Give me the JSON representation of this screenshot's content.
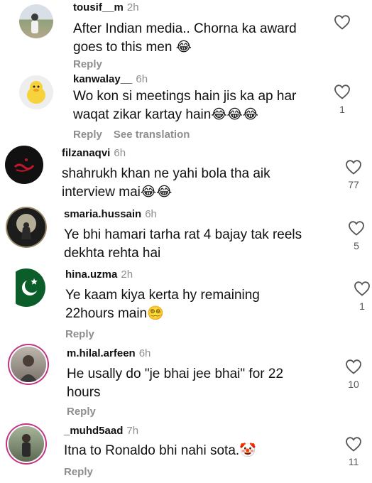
{
  "comments": [
    {
      "username": "tousif__m",
      "time": "2h",
      "text": "After Indian media.. Chorna ka award goes to this men 😂",
      "reply": "Reply",
      "see_translation": "",
      "likes": ""
    },
    {
      "username": "kanwalay__",
      "time": "6h",
      "text": "Wo kon si meetings hain jis ka ap har waqat zikar kartay hain😂😂😂",
      "reply": "Reply",
      "see_translation": "See translation",
      "likes": "1"
    },
    {
      "username": "filzanaqvi",
      "time": "6h",
      "text": "shahrukh khan ne yahi bola tha aik interview mai😂😂",
      "reply": "",
      "see_translation": "",
      "likes": "77"
    },
    {
      "username": "smaria.hussain",
      "time": "6h",
      "text": "Ye bhi hamari tarha rat 4 bajay tak reels dekhta rehta hai",
      "reply": "",
      "see_translation": "",
      "likes": "5"
    },
    {
      "username": "hina.uzma",
      "time": "2h",
      "text": "Ye kaam kiya kerta hy remaining 22hours main😵‍💫",
      "reply": "Reply",
      "see_translation": "",
      "likes": "1"
    },
    {
      "username": "m.hilal.arfeen",
      "time": "6h",
      "text": "He usally do \"je bhai jee bhai\" for 22 hours",
      "reply": "Reply",
      "see_translation": "",
      "likes": "10"
    },
    {
      "username": "_muhd5aad",
      "time": "7h",
      "text": "Itna to Ronaldo bhi nahi sota.🤡",
      "reply": "Reply",
      "see_translation": "",
      "likes": "11"
    }
  ]
}
